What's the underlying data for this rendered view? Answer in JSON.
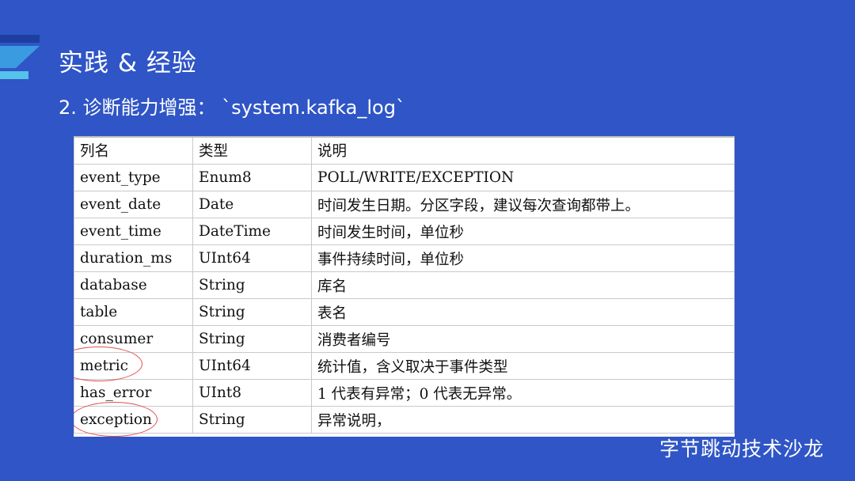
{
  "slide": {
    "title": "实践 & 经验",
    "subtitle": "2. 诊断能力增强： `system.kafka_log`",
    "brand": "字节跳动技术沙龙",
    "colors": {
      "background": "#2f55c6",
      "annotation": "#e05050"
    }
  },
  "table": {
    "headers": [
      "列名",
      "类型",
      "说明"
    ],
    "rows": [
      [
        "event_type",
        "Enum8",
        "POLL/WRITE/EXCEPTION"
      ],
      [
        "event_date",
        "Date",
        "时间发生日期。分区字段，建议每次查询都带上。"
      ],
      [
        "event_time",
        "DateTime",
        "时间发生时间，单位秒"
      ],
      [
        "duration_ms",
        "UInt64",
        "事件持续时间，单位秒"
      ],
      [
        "database",
        "String",
        "库名"
      ],
      [
        "table",
        "String",
        "表名"
      ],
      [
        "consumer",
        "String",
        "消费者编号"
      ],
      [
        "metric",
        "UInt64",
        "统计值，含义取决于事件类型"
      ],
      [
        "has_error",
        "UInt8",
        "1 代表有异常；0 代表无异常。"
      ],
      [
        "exception",
        "String",
        "异常说明，"
      ]
    ],
    "highlighted_columns": [
      "metric",
      "exception"
    ]
  }
}
